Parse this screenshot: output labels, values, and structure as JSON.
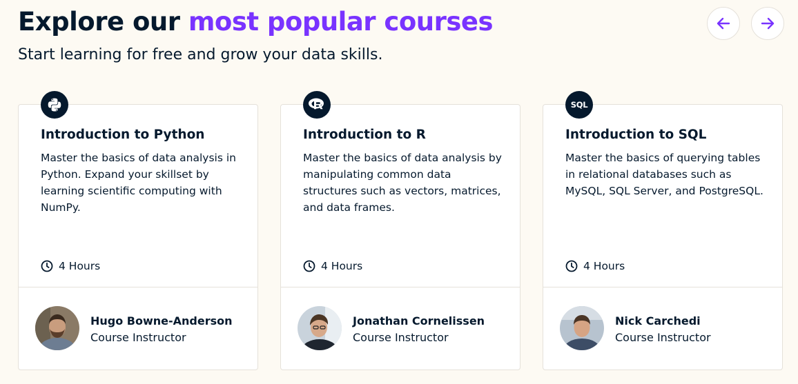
{
  "header": {
    "title_plain": "Explore our",
    "title_accent": "most popular courses",
    "subtitle": "Start learning for free and grow your data skills."
  },
  "nav": {
    "prev_icon": "arrow-left-icon",
    "next_icon": "arrow-right-icon"
  },
  "colors": {
    "accent": "#7933ff",
    "navy": "#05192d",
    "background": "#fdfaf3"
  },
  "courses": [
    {
      "icon": "python-icon",
      "title": "Introduction to Python",
      "description": "Master the basics of data analysis in Python. Expand your skillset by learning scientific computing with NumPy.",
      "duration": "4 Hours",
      "instructor": {
        "name": "Hugo Bowne-Anderson",
        "role": "Course Instructor"
      }
    },
    {
      "icon": "r-language-icon",
      "title": "Introduction to R",
      "description": "Master the basics of data analysis by manipulating common data structures such as vectors, matrices, and data frames.",
      "duration": "4 Hours",
      "instructor": {
        "name": "Jonathan Cornelissen",
        "role": "Course Instructor"
      }
    },
    {
      "icon": "sql-icon",
      "icon_text": "SQL",
      "title": "Introduction to SQL",
      "description": "Master the basics of querying tables in relational databases such as MySQL, SQL Server, and PostgreSQL.",
      "duration": "4 Hours",
      "instructor": {
        "name": "Nick Carchedi",
        "role": "Course Instructor"
      }
    }
  ]
}
